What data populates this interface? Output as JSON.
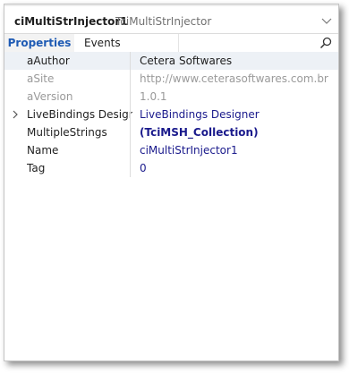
{
  "header": {
    "object_name": "ciMultiStrInjector1",
    "object_class": "TciMultiStrInjector"
  },
  "tabs": [
    {
      "label": "Properties"
    },
    {
      "label": "Events"
    }
  ],
  "properties": [
    {
      "name": "aAuthor",
      "value": "Cetera Softwares"
    },
    {
      "name": "aSite",
      "value": "http://www.ceterasoftwares.com.br"
    },
    {
      "name": "aVersion",
      "value": "1.0.1"
    },
    {
      "name": "LiveBindings Designer",
      "value": "LiveBindings Designer"
    },
    {
      "name": "MultipleStrings",
      "value": "(TciMSH_Collection)"
    },
    {
      "name": "Name",
      "value": "ciMultiStrInjector1"
    },
    {
      "name": "Tag",
      "value": "0"
    }
  ],
  "colors": {
    "active_tab_text": "#1f5bb4",
    "selected_row": "#edf1f6",
    "value_blue": "#1a1a8c",
    "readonly_gray": "#9a9a9a"
  },
  "icons": {
    "dropdown": "chevron-down-icon",
    "search": "search-icon",
    "expand": "chevron-right-icon"
  }
}
